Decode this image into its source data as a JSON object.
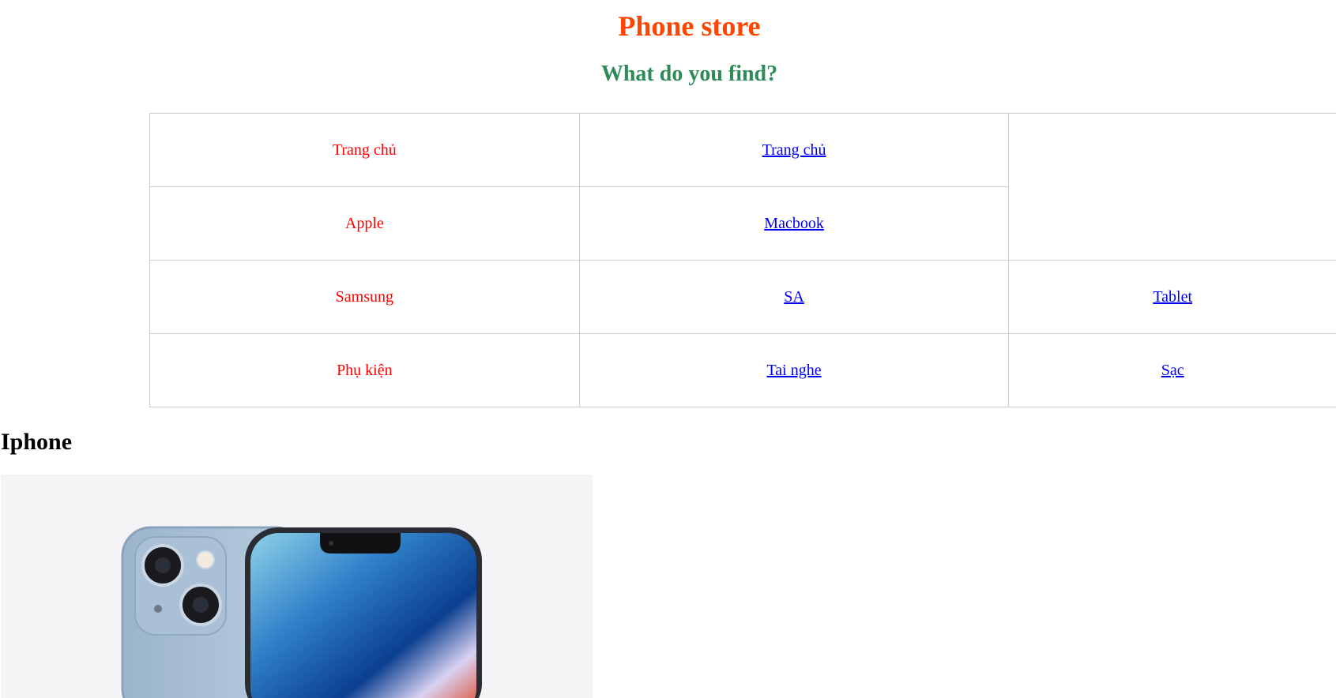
{
  "header": {
    "title": "Phone store",
    "subtitle": "What do you find?"
  },
  "menu": {
    "rows": [
      {
        "category": "Trang chủ",
        "links": [
          "Trang chủ"
        ]
      },
      {
        "category": "Apple",
        "links": [
          "Macbook"
        ]
      },
      {
        "category": "Samsung",
        "links": [
          "SA",
          "Tablet"
        ]
      },
      {
        "category": "Phụ kiện",
        "links": [
          "Tai nghe",
          "Sạc"
        ]
      }
    ]
  },
  "section": {
    "heading": "Iphone",
    "image_icon": "iphone-product-photo"
  },
  "colors": {
    "title": "#ff4500",
    "subtitle": "#2e8b57",
    "category_text": "#ff0000",
    "link": "#0000ee",
    "image_bg": "#f4f4f7"
  }
}
